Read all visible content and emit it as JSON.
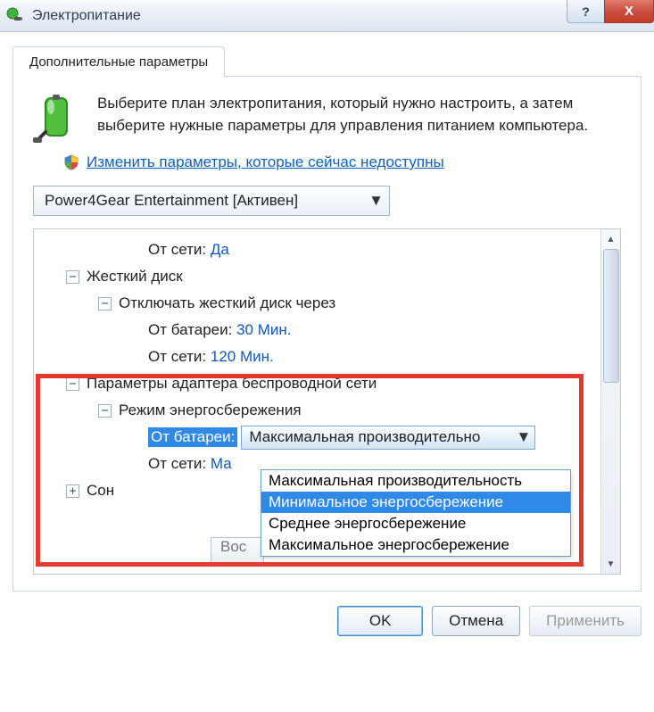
{
  "titlebar": {
    "title": "Электропитание",
    "help_glyph": "?",
    "close_glyph": "X"
  },
  "tab": {
    "label": "Дополнительные параметры"
  },
  "intro": {
    "text": "Выберите план электропитания, который нужно настроить, а затем выберите нужные параметры для управления питанием компьютера."
  },
  "uac_link": "Изменить параметры, которые сейчас недоступны",
  "plan_selector": {
    "value": "Power4Gear Entertainment [Активен]"
  },
  "tree": {
    "r1_label": "От сети:",
    "r1_value": "Да",
    "r2_label": "Жесткий диск",
    "r3_label": "Отключать жесткий диск через",
    "r4_label": "От батареи:",
    "r4_value": "30 Мин.",
    "r5_label": "От сети:",
    "r5_value": "120 Мин.",
    "r6_label": "Параметры адаптера беспроводной сети",
    "r7_label": "Режим энергосбережения",
    "r8_label": "От батареи:",
    "r8_combo": "Максимальная производительно",
    "r9_label": "От сети:",
    "r9_value": "Ма",
    "r10_label": "Сон"
  },
  "dropdown": {
    "opt0": "Максимальная производительность",
    "opt1": "Минимальное энергосбережение",
    "opt2": "Среднее энергосбережение",
    "opt3": "Максимальное энергосбережение"
  },
  "restore_button": "Вос",
  "buttons": {
    "ok": "OK",
    "cancel": "Отмена",
    "apply": "Применить"
  }
}
